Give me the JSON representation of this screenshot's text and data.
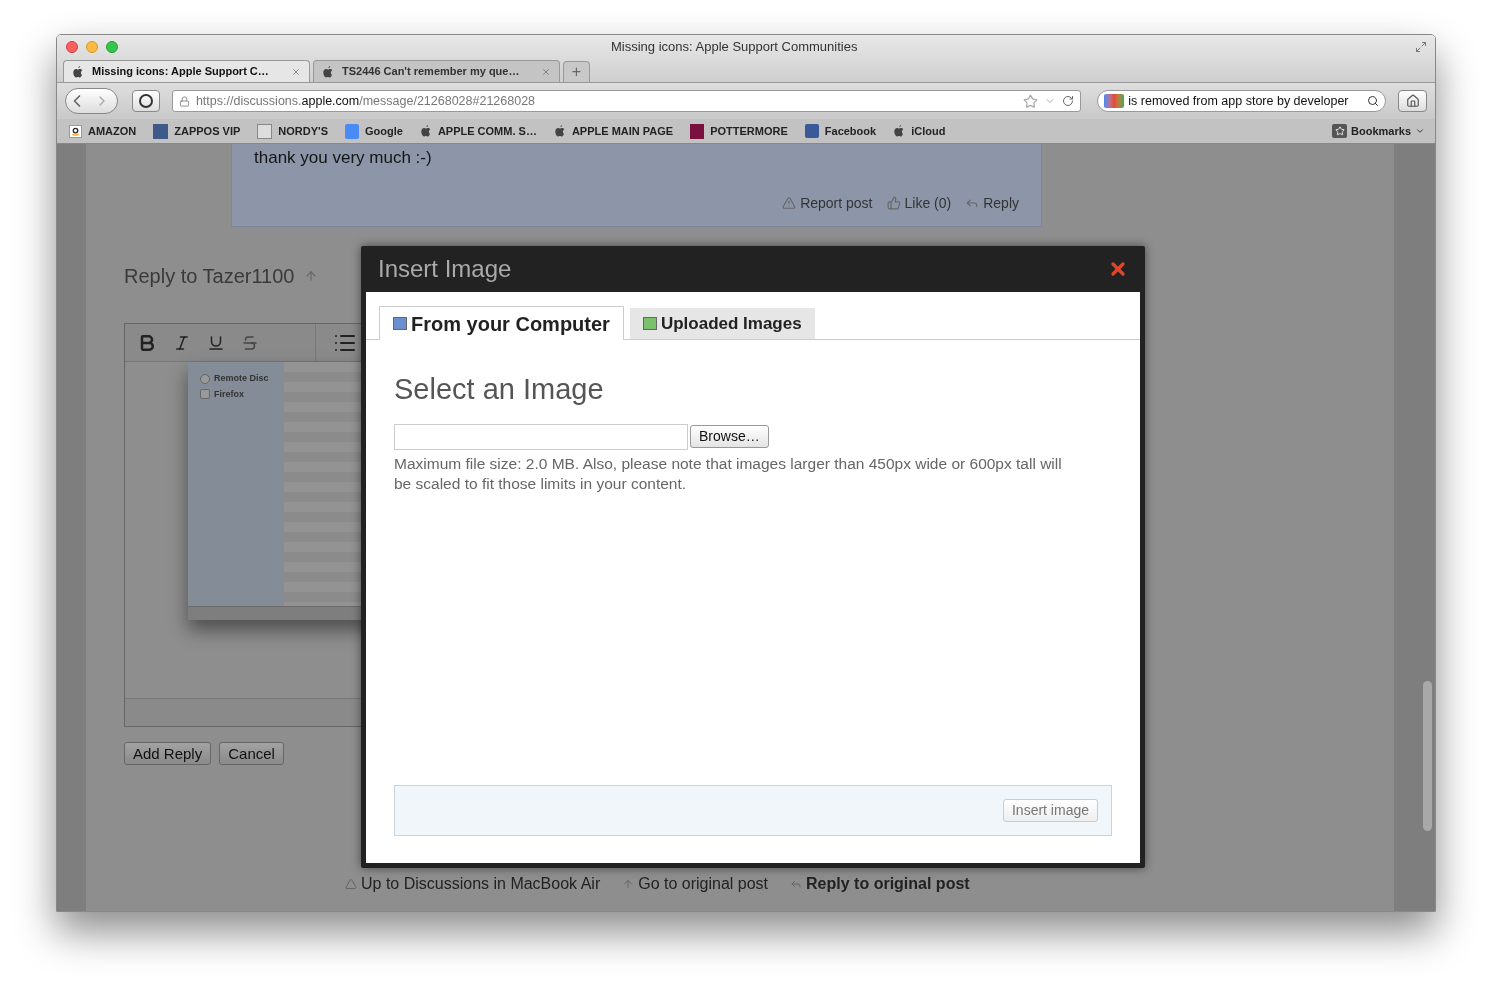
{
  "window": {
    "title": "Missing icons: Apple Support Communities"
  },
  "tabs": [
    {
      "label": "Missing icons: Apple Support C…",
      "selected": true
    },
    {
      "label": "TS2446 Can't remember my que…",
      "selected": false
    }
  ],
  "new_tab": "+",
  "toolbar": {
    "url_scheme": "https://discussions.",
    "url_domain": "apple.com",
    "url_path": "/message/21268028#21268028",
    "search_value": "is removed from app store by developer"
  },
  "bookmarks": [
    {
      "label": "AMAZON",
      "kind": "amazon"
    },
    {
      "label": "ZAPPOS VIP",
      "kind": "zappos"
    },
    {
      "label": "NORDY'S",
      "kind": "nordys"
    },
    {
      "label": "Google",
      "kind": "google"
    },
    {
      "label": "APPLE COMM. S…",
      "kind": "apple"
    },
    {
      "label": "APPLE MAIN PAGE",
      "kind": "apple"
    },
    {
      "label": "POTTERMORE",
      "kind": "pottermore"
    },
    {
      "label": "Facebook",
      "kind": "facebook"
    },
    {
      "label": "iCloud",
      "kind": "apple"
    }
  ],
  "bookmarks_menu": "Bookmarks",
  "post": {
    "text": "thank you very much :-)",
    "actions": [
      {
        "label": "Report post",
        "kind": "report"
      },
      {
        "label": "Like (0)",
        "kind": "like"
      },
      {
        "label": "Reply",
        "kind": "reply"
      }
    ]
  },
  "reply_heading": "Reply to Tazer1100",
  "embedded_screenshot": {
    "sidebar_items": [
      {
        "label": "Remote Disc",
        "kind": "disc"
      },
      {
        "label": "Firefox",
        "kind": "drive"
      }
    ]
  },
  "form_buttons": [
    "Add Reply",
    "Cancel"
  ],
  "footer_links": [
    {
      "label": "Up to Discussions in MacBook Air",
      "kind": "up"
    },
    {
      "label": "Go to original post",
      "kind": "go"
    },
    {
      "label": "Reply to original post",
      "kind": "reply"
    }
  ],
  "dialog": {
    "title": "Insert Image",
    "tabs": [
      {
        "label": "From your Computer",
        "selected": true
      },
      {
        "label": "Uploaded Images",
        "selected": false
      }
    ],
    "heading": "Select an Image",
    "browse_button": "Browse…",
    "note": "Maximum file size: 2.0 MB. Also, please note that images larger than 450px wide or 600px tall will be scaled to fit those limits in your content.",
    "insert_button": "Insert image"
  }
}
